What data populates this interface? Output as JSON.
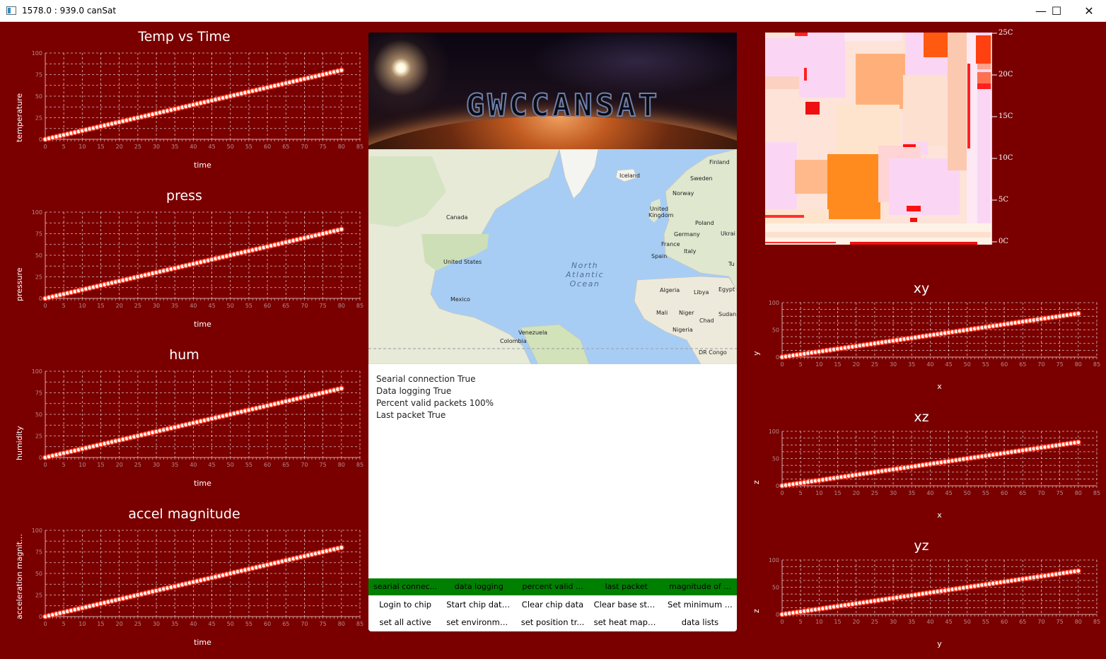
{
  "window": {
    "title": "1578.0 : 939.0 canSat",
    "minimize_glyph": "—",
    "maximize_glyph": "☐",
    "close_glyph": "✕"
  },
  "banner": {
    "logo_text": "GWCCANSAT"
  },
  "map": {
    "labels": [
      "Finland",
      "Iceland",
      "Sweden",
      "Norway",
      "Canada",
      "United Kingdom",
      "Poland",
      "Germany",
      "Ukrai",
      "France",
      "Italy",
      "Spain",
      "United States",
      "Tu",
      "North Atlantic Ocean",
      "Algeria",
      "Libya",
      "Egypt",
      "Mexico",
      "Mali",
      "Niger",
      "Sudan",
      "Chad",
      "Venezuela",
      "Nigeria",
      "Colombia",
      "DR Congo"
    ]
  },
  "status_lines": [
    "Searial connection True",
    "Data logging True",
    "Percent valid packets 100%",
    "Last packet True"
  ],
  "status_bar": [
    "searial connec...",
    "data logging",
    "percent valid ...",
    "last packet",
    "magnitude of ..."
  ],
  "buttons_row1": [
    "Login to chip",
    "Start chip data...",
    "Clear chip data",
    "Clear base stat...",
    "Set minimum ..."
  ],
  "buttons_row2": [
    "set all active",
    "set environme...",
    "set position tr...",
    "set heat mapp...",
    "data lists"
  ],
  "heatmap": {
    "scale_ticks": [
      "25C",
      "20C",
      "15C",
      "10C",
      "5C",
      "0C"
    ]
  },
  "colors": {
    "background": "#7a0000",
    "status_ok": "#008000",
    "line": "#ff3b1f"
  },
  "chart_data": [
    {
      "type": "line",
      "title": "Temp vs Time",
      "xlabel": "time",
      "ylabel": "temperature",
      "xticks": [
        "0",
        "5",
        "10",
        "15",
        "20",
        "25",
        "30",
        "35",
        "40",
        "45",
        "50",
        "55",
        "60",
        "65",
        "70",
        "75",
        "80",
        "85"
      ],
      "yticks": [
        "0",
        "25",
        "50",
        "75",
        "100"
      ],
      "xlim": [
        0,
        85
      ],
      "ylim": [
        0,
        100
      ],
      "series": [
        {
          "x": [
            0,
            80
          ],
          "y": [
            0,
            80
          ]
        }
      ]
    },
    {
      "type": "line",
      "title": "press",
      "xlabel": "time",
      "ylabel": "pressure",
      "xticks": [
        "0",
        "5",
        "10",
        "15",
        "20",
        "25",
        "30",
        "35",
        "40",
        "45",
        "50",
        "55",
        "60",
        "65",
        "70",
        "75",
        "80",
        "85"
      ],
      "yticks": [
        "0",
        "25",
        "50",
        "75",
        "100"
      ],
      "xlim": [
        0,
        85
      ],
      "ylim": [
        0,
        100
      ],
      "series": [
        {
          "x": [
            0,
            80
          ],
          "y": [
            0,
            80
          ]
        }
      ]
    },
    {
      "type": "line",
      "title": "hum",
      "xlabel": "time",
      "ylabel": "humidity",
      "xticks": [
        "0",
        "5",
        "10",
        "15",
        "20",
        "25",
        "30",
        "35",
        "40",
        "45",
        "50",
        "55",
        "60",
        "65",
        "70",
        "75",
        "80",
        "85"
      ],
      "yticks": [
        "0",
        "25",
        "50",
        "75",
        "100"
      ],
      "xlim": [
        0,
        85
      ],
      "ylim": [
        0,
        100
      ],
      "series": [
        {
          "x": [
            0,
            80
          ],
          "y": [
            0,
            80
          ]
        }
      ]
    },
    {
      "type": "line",
      "title": "accel magnitude",
      "xlabel": "time",
      "ylabel": "acceleration magnitu...",
      "xticks": [
        "0",
        "5",
        "10",
        "15",
        "20",
        "25",
        "30",
        "35",
        "40",
        "45",
        "50",
        "55",
        "60",
        "65",
        "70",
        "75",
        "80",
        "85"
      ],
      "yticks": [
        "0",
        "25",
        "50",
        "75",
        "100"
      ],
      "xlim": [
        0,
        85
      ],
      "ylim": [
        0,
        100
      ],
      "series": [
        {
          "x": [
            0,
            80
          ],
          "y": [
            0,
            80
          ]
        }
      ]
    },
    {
      "type": "line",
      "title": "xy",
      "xlabel": "x",
      "ylabel": "y",
      "xticks": [
        "0",
        "5",
        "10",
        "15",
        "20",
        "25",
        "30",
        "35",
        "40",
        "45",
        "50",
        "55",
        "60",
        "65",
        "70",
        "75",
        "80",
        "85"
      ],
      "yticks": [
        "0",
        "50",
        "100"
      ],
      "xlim": [
        0,
        85
      ],
      "ylim": [
        0,
        100
      ],
      "series": [
        {
          "x": [
            0,
            80
          ],
          "y": [
            0,
            80
          ]
        }
      ]
    },
    {
      "type": "line",
      "title": "xz",
      "xlabel": "x",
      "ylabel": "z",
      "xticks": [
        "0",
        "5",
        "10",
        "15",
        "20",
        "25",
        "30",
        "35",
        "40",
        "45",
        "50",
        "55",
        "60",
        "65",
        "70",
        "75",
        "80",
        "85"
      ],
      "yticks": [
        "0",
        "50",
        "100"
      ],
      "xlim": [
        0,
        85
      ],
      "ylim": [
        0,
        100
      ],
      "series": [
        {
          "x": [
            0,
            80
          ],
          "y": [
            0,
            80
          ]
        }
      ]
    },
    {
      "type": "line",
      "title": "yz",
      "xlabel": "y",
      "ylabel": "z",
      "xticks": [
        "0",
        "5",
        "10",
        "15",
        "20",
        "25",
        "30",
        "35",
        "40",
        "45",
        "50",
        "55",
        "60",
        "65",
        "70",
        "75",
        "80",
        "85"
      ],
      "yticks": [
        "0",
        "50",
        "100"
      ],
      "xlim": [
        0,
        85
      ],
      "ylim": [
        0,
        100
      ],
      "series": [
        {
          "x": [
            0,
            80
          ],
          "y": [
            0,
            80
          ]
        }
      ]
    }
  ]
}
